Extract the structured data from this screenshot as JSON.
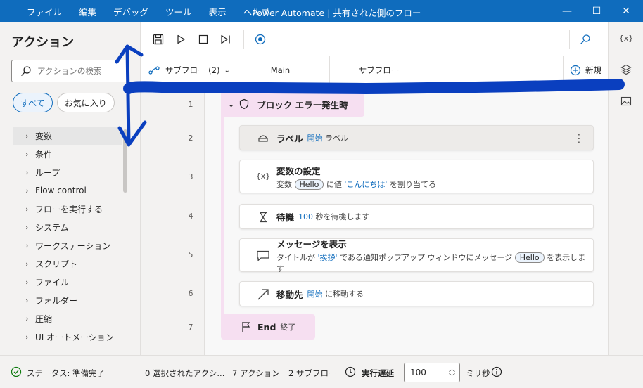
{
  "titlebar": {
    "menu": [
      "ファイル",
      "編集",
      "デバッグ",
      "ツール",
      "表示",
      "ヘルプ"
    ],
    "title": "Power Automate | 共有された側のフロー",
    "minimize": "—",
    "maximize": "☐",
    "close": "✕"
  },
  "actions_panel": {
    "title": "アクション",
    "search_placeholder": "アクションの検索",
    "tabs": [
      "すべて",
      "お気に入り"
    ],
    "items": [
      "変数",
      "条件",
      "ループ",
      "Flow control",
      "フローを実行する",
      "システム",
      "ワークステーション",
      "スクリプト",
      "ファイル",
      "フォルダー",
      "圧縮",
      "UI オートメーション"
    ]
  },
  "subflow_bar": {
    "subflows_label": "サブフロー (2)",
    "tabs": [
      "Main",
      "サブフロー"
    ],
    "new_label": "新規"
  },
  "flow": {
    "line_numbers": [
      "1",
      "2",
      "3",
      "4",
      "5",
      "6",
      "7"
    ],
    "block_head": "ブロック エラー発生時",
    "steps": [
      {
        "title": "ラベル",
        "kw1": "開始",
        "rest1": "ラベル"
      },
      {
        "title": "変数の設定",
        "pre": "変数",
        "pill": "Hello",
        "mid": "に値",
        "kw": "'こんにちは'",
        "post": "を割り当てる"
      },
      {
        "title": "待機",
        "kw": "100",
        "post": "秒を待機します"
      },
      {
        "title": "メッセージを表示",
        "pre": "タイトルが",
        "kw": "'挨拶'",
        "mid": "である通知ポップアップ ウィンドウにメッセージ",
        "pill": "Hello",
        "post": "を表示します"
      },
      {
        "title": "移動先",
        "kw": "開始",
        "post": "に移動する"
      }
    ],
    "block_end_title": "End",
    "block_end_desc": "終了"
  },
  "right_rail": {
    "variables_icon": "{x}"
  },
  "status": {
    "status_text": "ステータス: 準備完了",
    "selected": "0 選択されたアクシ...",
    "actions_count": "7 アクション",
    "subflows_count": "2 サブフロー",
    "delay_label": "実行遅延",
    "delay_value": "100",
    "unit": "ミリ秒"
  },
  "colors": {
    "accent": "#0f6cbd",
    "block": "#f6dff1",
    "annotation": "#0a3fbf"
  }
}
